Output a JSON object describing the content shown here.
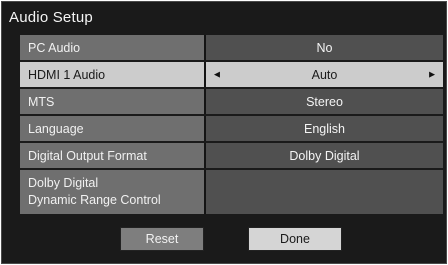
{
  "window": {
    "title": "Audio Setup"
  },
  "menu": {
    "rows": [
      {
        "label": "PC Audio",
        "value": "No"
      },
      {
        "label": "HDMI 1 Audio",
        "value": "Auto",
        "left_arrow": "◄",
        "right_arrow": "►"
      },
      {
        "label": "MTS",
        "value": "Stereo"
      },
      {
        "label": "Language",
        "value": "English"
      },
      {
        "label": "Digital Output Format",
        "value": "Dolby Digital"
      },
      {
        "label_line1": "Dolby Digital",
        "label_line2": "Dynamic Range Control",
        "value": ""
      }
    ]
  },
  "buttons": {
    "reset_label": "Reset",
    "done_label": "Done"
  },
  "colors": {
    "background": "#141414",
    "label_bg": "#6b6b6b",
    "value_bg": "#4c4c4c",
    "selected_bg": "#c9c9c9"
  }
}
